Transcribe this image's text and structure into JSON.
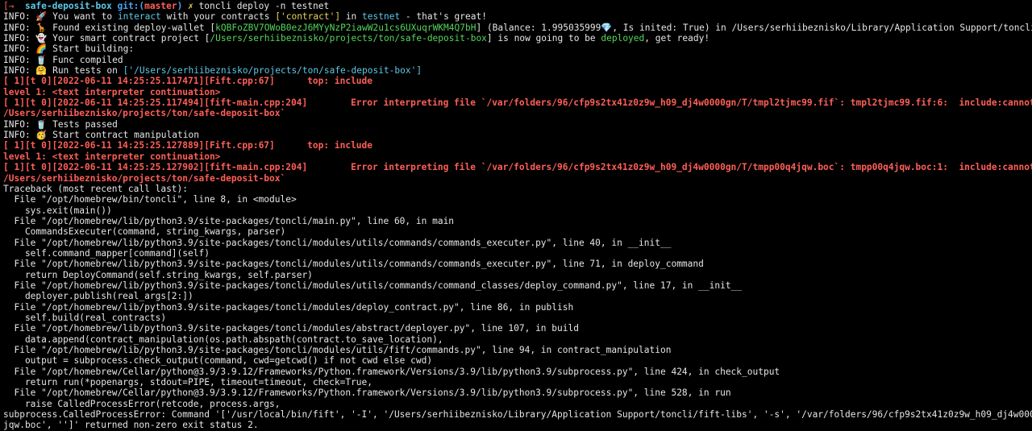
{
  "colors": {
    "background": "#000000",
    "text": "#e6e6e6",
    "error": "#ff5f57",
    "cyan": "#5ec8e6",
    "green": "#55d65b",
    "yellow": "#e6d35b",
    "blue": "#49a4f3"
  },
  "lines": [
    [
      {
        "t": "[→  ",
        "c": "red"
      },
      {
        "t": "safe-deposit-box",
        "c": "cyan bold"
      },
      {
        "t": " git:(",
        "c": "blue bold"
      },
      {
        "t": "master",
        "c": "red bold"
      },
      {
        "t": ")",
        "c": "blue bold"
      },
      {
        "t": " ✗",
        "c": "yellow"
      },
      {
        "t": " toncli deploy -n testnet"
      }
    ],
    [
      {
        "t": "INFO: 🚀 You want to "
      },
      {
        "t": "interact",
        "c": "cyan"
      },
      {
        "t": " with your contracts "
      },
      {
        "t": "['contract']",
        "c": "yellow"
      },
      {
        "t": " in "
      },
      {
        "t": "testnet",
        "c": "cyan"
      },
      {
        "t": " - that's great!"
      }
    ],
    [
      {
        "t": "INFO: 🦒 Found existing deploy-wallet ["
      },
      {
        "t": "kQBFoZBV7OWoB0ezJ6MYyNzP2iawW2u1cs6UXuqrWKM4Q7bH",
        "c": "green"
      },
      {
        "t": "] (Balance: 1.995035999💎, Is inited: True) in /Users/serhiibeznisko/Library/Application Support/toncli"
      }
    ],
    [
      {
        "t": "INFO: 👻 Your smart contract project ["
      },
      {
        "t": "/Users/serhiibeznisko/projects/ton/safe-deposit-box",
        "c": "green"
      },
      {
        "t": "] is now going to be "
      },
      {
        "t": "deployed",
        "c": "green"
      },
      {
        "t": ", get ready!"
      }
    ],
    [
      {
        "t": "INFO: 🌈 Start building:"
      }
    ],
    [
      {
        "t": "INFO: 🥤 Func compiled"
      }
    ],
    [
      {
        "t": "INFO: 🤗 Run tests on "
      },
      {
        "t": "['/Users/serhiibeznisko/projects/ton/safe-deposit-box']",
        "c": "cyan"
      }
    ],
    [
      {
        "t": "[ 1][t 0][2022-06-11 14:25:25.117471][Fift.cpp:67]      top: include",
        "c": "red bold"
      }
    ],
    [
      {
        "t": "level 1: <text interpreter continuation>",
        "c": "red bold"
      }
    ],
    [
      {
        "t": "[ 1][t 0][2022-06-11 14:25:25.117494][fift-main.cpp:204]        Error interpreting file `/var/folders/96/cfp9s2tx41z0z9w_h09_dj4w0000gn/T/tmpl2tjmc99.fif`: tmpl2tjmc99.fif:6:  include:cannot locate file `",
        "c": "red bold"
      }
    ],
    [
      {
        "t": "/Users/serhiibeznisko/projects/ton/safe-deposit-box`",
        "c": "red bold"
      }
    ],
    [
      {
        "t": "INFO: 🥤 Tests passed"
      }
    ],
    [
      {
        "t": "INFO: 🥳 Start contract manipulation"
      }
    ],
    [
      {
        "t": "[ 1][t 0][2022-06-11 14:25:25.127889][Fift.cpp:67]      top: include",
        "c": "red bold"
      }
    ],
    [
      {
        "t": "level 1: <text interpreter continuation>",
        "c": "red bold"
      }
    ],
    [
      {
        "t": "[ 1][t 0][2022-06-11 14:25:25.127902][fift-main.cpp:204]        Error interpreting file `/var/folders/96/cfp9s2tx41z0z9w_h09_dj4w0000gn/T/tmpp00q4jqw.boc`: tmpp00q4jqw.boc:1:  include:cannot locate file `",
        "c": "red bold"
      }
    ],
    [
      {
        "t": "/Users/serhiibeznisko/projects/ton/safe-deposit-box`",
        "c": "red bold"
      }
    ],
    [
      {
        "t": "Traceback (most recent call last):"
      }
    ],
    [
      {
        "t": "  File \"/opt/homebrew/bin/toncli\", line 8, in <module>"
      }
    ],
    [
      {
        "t": "    sys.exit(main())"
      }
    ],
    [
      {
        "t": "  File \"/opt/homebrew/lib/python3.9/site-packages/toncli/main.py\", line 60, in main"
      }
    ],
    [
      {
        "t": "    CommandsExecuter(command, string_kwargs, parser)"
      }
    ],
    [
      {
        "t": "  File \"/opt/homebrew/lib/python3.9/site-packages/toncli/modules/utils/commands/commands_executer.py\", line 40, in __init__"
      }
    ],
    [
      {
        "t": "    self.command_mapper[command](self)"
      }
    ],
    [
      {
        "t": "  File \"/opt/homebrew/lib/python3.9/site-packages/toncli/modules/utils/commands/commands_executer.py\", line 71, in deploy_command"
      }
    ],
    [
      {
        "t": "    return DeployCommand(self.string_kwargs, self.parser)"
      }
    ],
    [
      {
        "t": "  File \"/opt/homebrew/lib/python3.9/site-packages/toncli/modules/utils/commands/command_classes/deploy_command.py\", line 17, in __init__"
      }
    ],
    [
      {
        "t": "    deployer.publish(real_args[2:])"
      }
    ],
    [
      {
        "t": "  File \"/opt/homebrew/lib/python3.9/site-packages/toncli/modules/deploy_contract.py\", line 86, in publish"
      }
    ],
    [
      {
        "t": "    self.build(real_contracts)"
      }
    ],
    [
      {
        "t": "  File \"/opt/homebrew/lib/python3.9/site-packages/toncli/modules/abstract/deployer.py\", line 107, in build"
      }
    ],
    [
      {
        "t": "    data.append(contract_manipulation(os.path.abspath(contract.to_save_location),"
      }
    ],
    [
      {
        "t": "  File \"/opt/homebrew/lib/python3.9/site-packages/toncli/modules/utils/fift/commands.py\", line 94, in contract_manipulation"
      }
    ],
    [
      {
        "t": "    output = subprocess.check_output(command, cwd=getcwd() if not cwd else cwd)"
      }
    ],
    [
      {
        "t": "  File \"/opt/homebrew/Cellar/python@3.9/3.9.12/Frameworks/Python.framework/Versions/3.9/lib/python3.9/subprocess.py\", line 424, in check_output"
      }
    ],
    [
      {
        "t": "    return run(*popenargs, stdout=PIPE, timeout=timeout, check=True,"
      }
    ],
    [
      {
        "t": "  File \"/opt/homebrew/Cellar/python@3.9/3.9.12/Frameworks/Python.framework/Versions/3.9/lib/python3.9/subprocess.py\", line 528, in run"
      }
    ],
    [
      {
        "t": "    raise CalledProcessError(retcode, process.args,"
      }
    ],
    [
      {
        "t": "subprocess.CalledProcessError: Command '['/usr/local/bin/fift', '-I', '/Users/serhiibeznisko/Library/Application Support/toncli/fift-libs', '-s', '/var/folders/96/cfp9s2tx41z0z9w_h09_dj4w0000gn/T/tmpp00q4"
      }
    ],
    [
      {
        "t": "jqw.boc', '']' returned non-zero exit status 2."
      }
    ]
  ]
}
